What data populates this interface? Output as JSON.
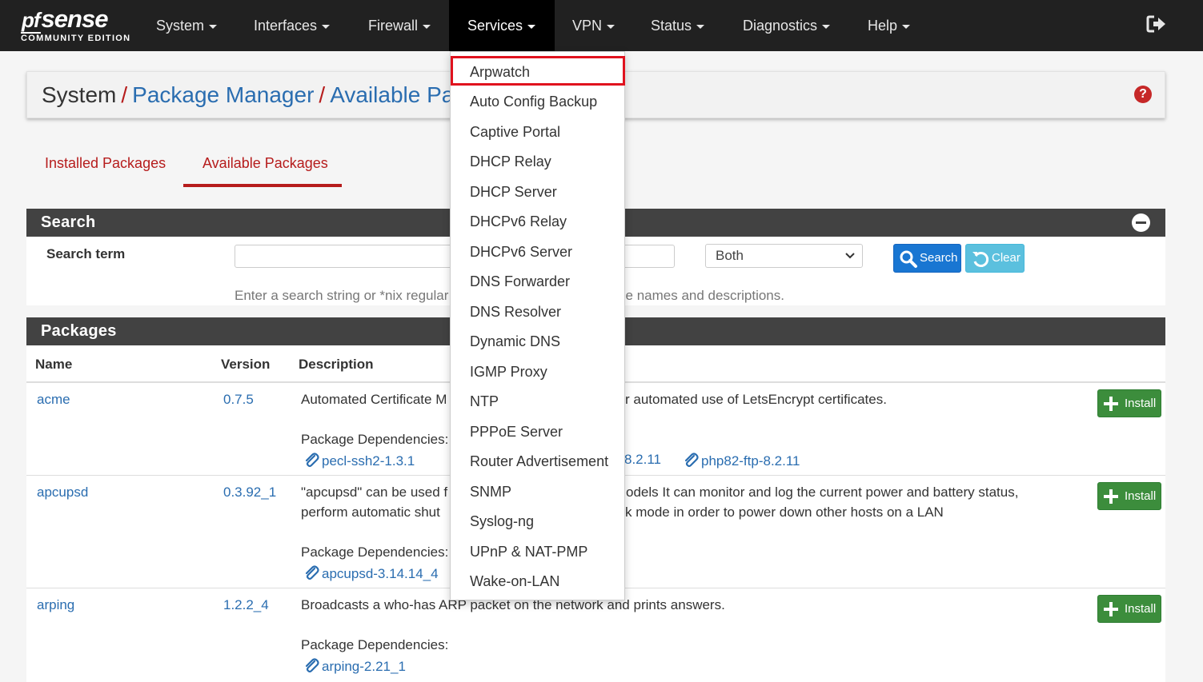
{
  "navbar": {
    "brand_pf": "pf",
    "brand_sense": "sense",
    "brand_edition": "COMMUNITY EDITION",
    "items": [
      "System",
      "Interfaces",
      "Firewall",
      "Services",
      "VPN",
      "Status",
      "Diagnostics",
      "Help"
    ],
    "active": "Services"
  },
  "breadcrumb": {
    "root": "System",
    "sep": "/",
    "level1": "Package Manager",
    "level2": "Available Packages"
  },
  "tabs": [
    "Installed Packages",
    "Available Packages"
  ],
  "search_panel": {
    "title": "Search",
    "label": "Search term",
    "input_value": "",
    "select_value": "Both",
    "search_button": "Search",
    "clear_button": "Clear",
    "help_text": "Enter a search string or *nix regular expression to search package names and descriptions."
  },
  "packages_panel": {
    "title": "Packages",
    "columns": [
      "Name",
      "Version",
      "Description"
    ],
    "install_label": "Install",
    "dependencies_label": "Package Dependencies:",
    "rows": [
      {
        "name": "acme",
        "version": "0.7.5",
        "desc_line1_left": "Automated Certificate M",
        "desc_line1_right": "r automated use of LetsEncrypt certificates.",
        "deps": [
          "pecl-ssh2-1.3.1",
          "8.2.11",
          "php82-ftp-8.2.11"
        ]
      },
      {
        "name": "apcupsd",
        "version": "0.3.92_1",
        "desc_line1_left": "\"apcupsd\" can be used f",
        "desc_line1_right": "odels It can monitor and log the current power and battery status,",
        "desc_line2_left": "perform automatic shut",
        "desc_line2_right": "k mode in order to power down other hosts on a LAN",
        "deps": [
          "apcupsd-3.14.14_4"
        ]
      },
      {
        "name": "arping",
        "version": "1.2.2_4",
        "desc_line1_full": "Broadcasts a who-has ARP packet on the network and prints answers.",
        "deps": [
          "arping-2.21_1"
        ]
      }
    ]
  },
  "services_menu": {
    "items": [
      "Arpwatch",
      "Auto Config Backup",
      "Captive Portal",
      "DHCP Relay",
      "DHCP Server",
      "DHCPv6 Relay",
      "DHCPv6 Server",
      "DNS Forwarder",
      "DNS Resolver",
      "Dynamic DNS",
      "IGMP Proxy",
      "NTP",
      "PPPoE Server",
      "Router Advertisement",
      "SNMP",
      "Syslog-ng",
      "UPnP & NAT-PMP",
      "Wake-on-LAN"
    ],
    "highlighted": "Arpwatch",
    "highlight_color": "#e0121e"
  },
  "colors": {
    "navbar": "#212121",
    "accent_red": "#b61c1c",
    "link_blue": "#2a6db0",
    "install_green": "#3c8d3c"
  }
}
